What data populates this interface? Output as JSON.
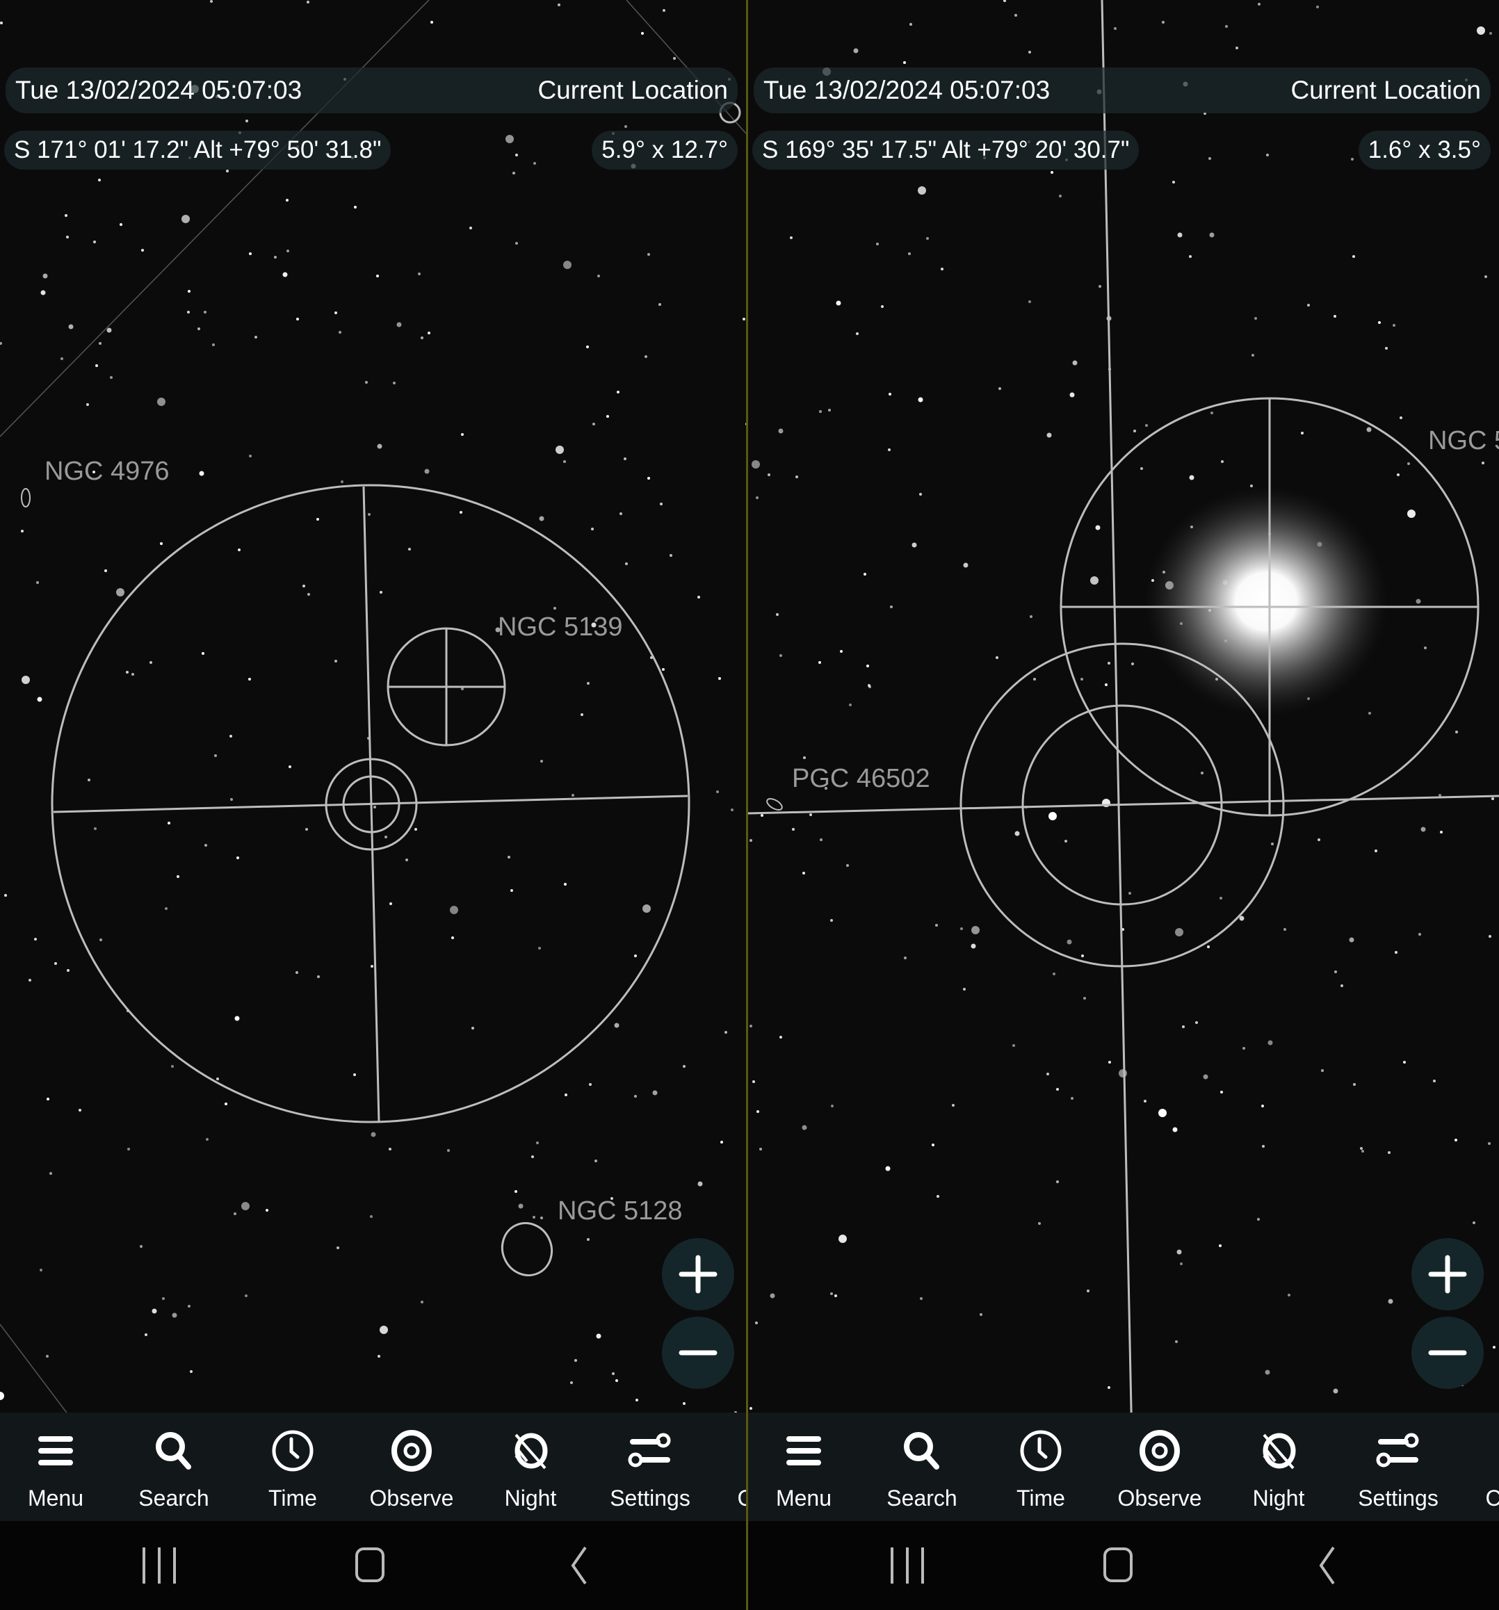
{
  "panels": [
    {
      "datetime": "Tue 13/02/2024  05:07:03",
      "location": "Current Location",
      "coords": "S 171° 01' 17.2\" Alt +79° 50' 31.8\"",
      "fov": "5.9° x 12.7°",
      "labels": [
        "NGC 4976",
        "NGC 5139",
        "NGC 5128"
      ]
    },
    {
      "datetime": "Tue 13/02/2024  05:07:03",
      "location": "Current Location",
      "coords": "S 169° 35' 17.5\" Alt +79° 20' 30.7\"",
      "fov": "1.6° x  3.5°",
      "labels": [
        "NGC 5",
        "PGC 46502"
      ]
    }
  ],
  "nav": [
    "Menu",
    "Search",
    "Time",
    "Observe",
    "Night",
    "Settings",
    "C"
  ],
  "icons": [
    "menu-icon",
    "search-icon",
    "clock-icon",
    "eye-icon",
    "night-mode-icon",
    "settings-sliders-icon"
  ],
  "colors": {
    "background": "#0b0b0b",
    "overlay": "#bdbdbd",
    "label": "#9a9a9a",
    "bar": "#12171a"
  }
}
